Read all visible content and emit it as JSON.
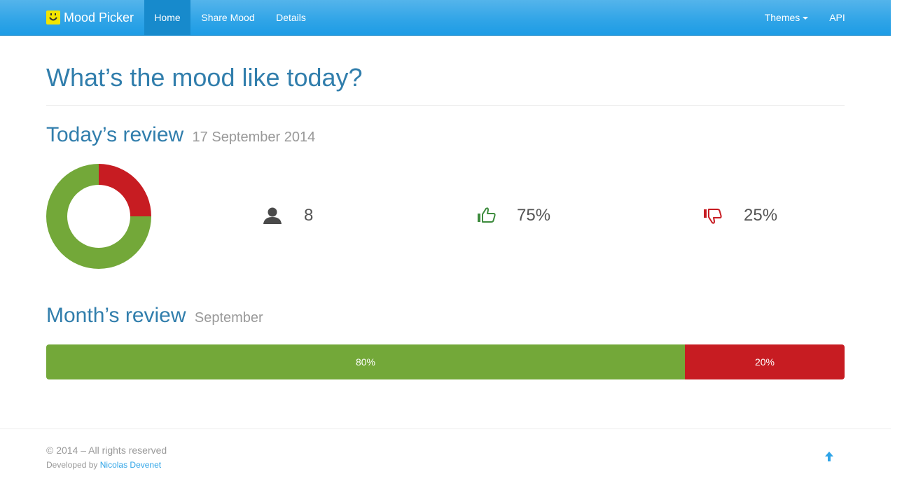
{
  "nav": {
    "brand": "Mood Picker",
    "items": [
      {
        "label": "Home",
        "active": true
      },
      {
        "label": "Share Mood",
        "active": false
      },
      {
        "label": "Details",
        "active": false
      }
    ],
    "themes": "Themes",
    "api": "API"
  },
  "main": {
    "title": "What’s the mood like today?",
    "today": {
      "title": "Today’s review",
      "date": "17 September 2014",
      "participants": "8",
      "positive": "75%",
      "negative": "25%",
      "icons": {
        "participants": "user-icon",
        "positive": "thumbs-up-icon",
        "negative": "thumbs-down-icon"
      }
    },
    "month": {
      "title": "Month’s review",
      "subtitle": "September",
      "positive_label": "80%",
      "negative_label": "20%"
    }
  },
  "chart_data": [
    {
      "type": "pie",
      "title": "",
      "categories": [
        "Positive",
        "Negative"
      ],
      "values": [
        75,
        25
      ],
      "colors": [
        "#73a839",
        "#c71c22"
      ]
    },
    {
      "type": "bar",
      "title": "",
      "orientation": "horizontal-stacked",
      "categories": [
        "Positive",
        "Negative"
      ],
      "values": [
        80,
        20
      ],
      "colors": [
        "#73a839",
        "#c71c22"
      ]
    }
  ],
  "footer": {
    "copyright": "© 2014 – All rights reserved",
    "developed_by": "Developed by",
    "author": "Nicolas Devenet",
    "back_to_top": "arrow-up-icon"
  },
  "colors": {
    "navbar": "#2fa4e7",
    "positive": "#73a839",
    "negative": "#c71c22",
    "heading": "#317eac"
  }
}
